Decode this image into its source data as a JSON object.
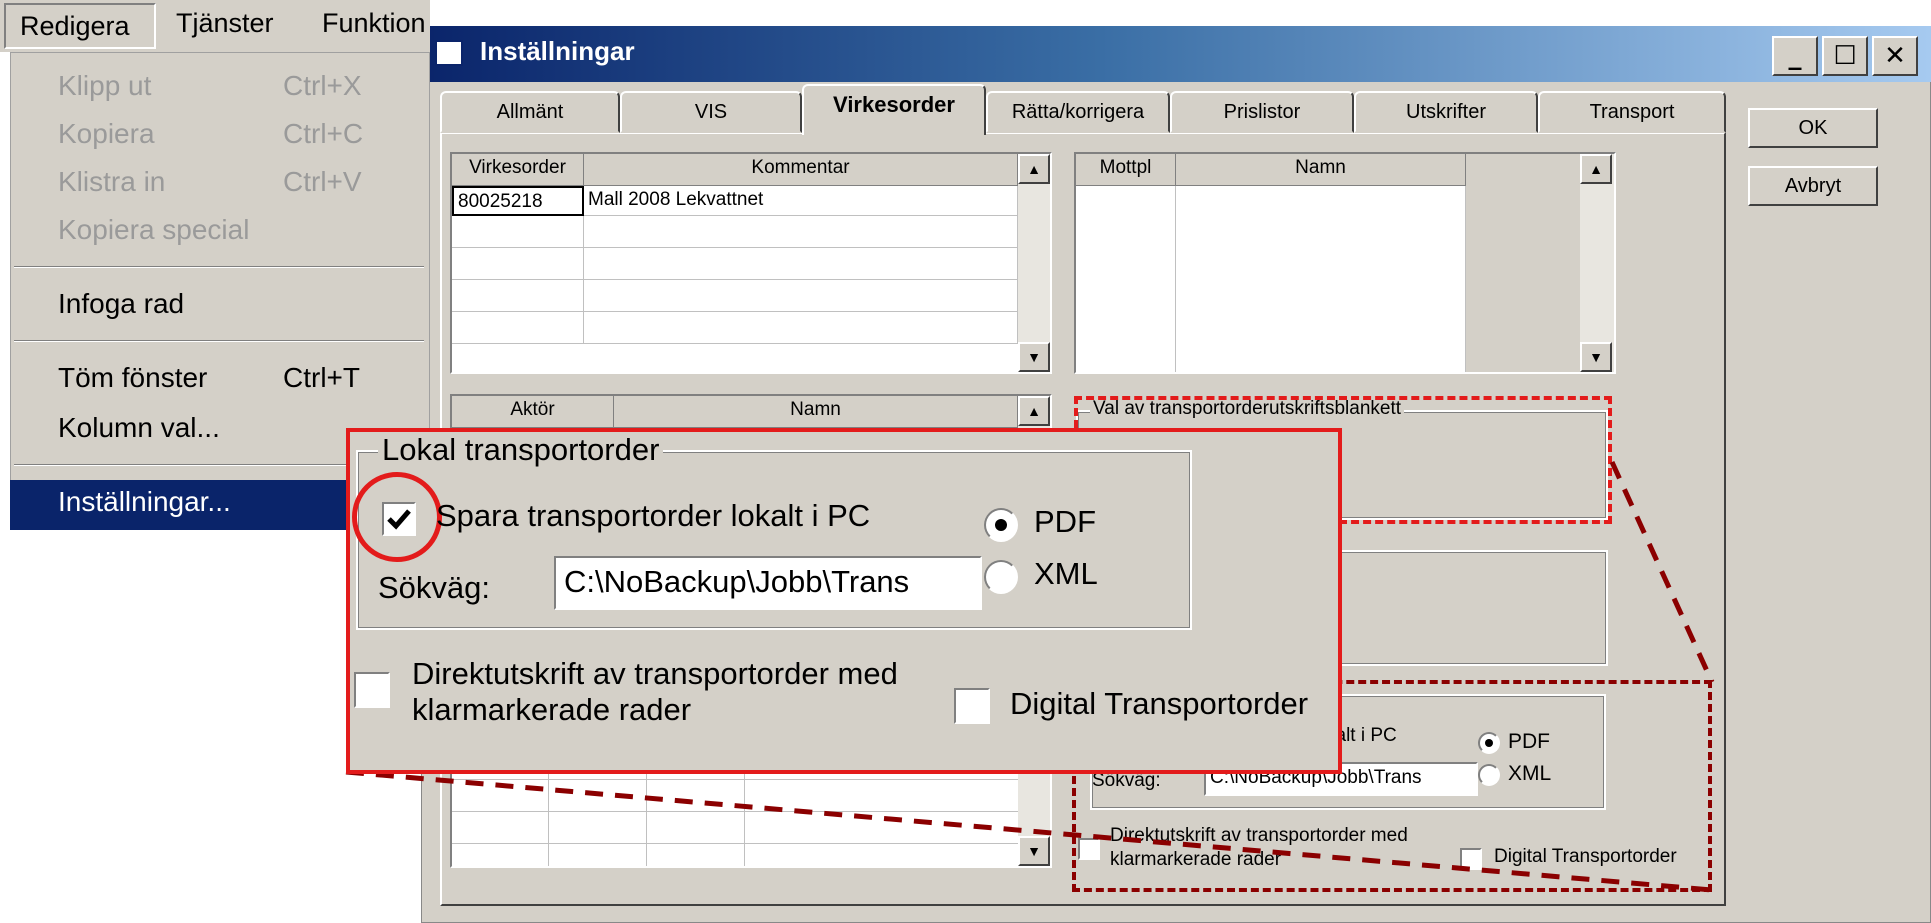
{
  "menu": {
    "top_items": [
      "Redigera",
      "Tjänster",
      "Funktion"
    ],
    "items": [
      {
        "label": "Klipp ut",
        "shortcut": "Ctrl+X"
      },
      {
        "label": "Kopiera",
        "shortcut": "Ctrl+C"
      },
      {
        "label": "Klistra in",
        "shortcut": "Ctrl+V"
      },
      {
        "label": "Kopiera special",
        "shortcut": ""
      },
      {
        "label": "Infoga rad",
        "shortcut": ""
      },
      {
        "label": "Töm fönster",
        "shortcut": "Ctrl+T"
      },
      {
        "label": "Kolumn val...",
        "shortcut": ""
      },
      {
        "label": "Inställningar...",
        "shortcut": ""
      }
    ]
  },
  "window": {
    "title": "Inställningar",
    "controls": [
      "_",
      "☐",
      "✕"
    ],
    "ok_label": "OK",
    "cancel_label": "Avbryt"
  },
  "tabs": [
    "Allmänt",
    "VIS",
    "Virkesorder",
    "Rätta/korrigera",
    "Prislistor",
    "Utskrifter",
    "Transport"
  ],
  "virkesorder_table": {
    "columns": [
      "Virkesorder",
      "Kommentar"
    ],
    "rows": [
      [
        "80025218",
        "Mall 2008 Lekvattnet"
      ]
    ]
  },
  "mottpl_table": {
    "columns": [
      "Mottpl",
      "Namn"
    ]
  },
  "aktor_table": {
    "columns": [
      "Aktör",
      "Namn"
    ]
  },
  "transport_form": {
    "group_title": "Val av transportorderutskriftsblankett",
    "local_group": "Lokal transportorder",
    "save_local_label": "Spara transportorder lokalt i PC",
    "save_local_partial": "kalt i PC",
    "path_label": "Sökväg:",
    "path_value": "C:\\NoBackup\\Jobb\\Trans",
    "format_pdf": "PDF",
    "format_xml": "XML",
    "direct_print_label_1": "Direktutskrift av transportorder med",
    "direct_print_label_2": "klarmarkerade rader",
    "digital_label": "Digital Transportorder",
    "save_local_checked": true,
    "format_selected": "PDF"
  },
  "colors": {
    "highlight_red": "#e31b1b",
    "dashed_dark_red": "#8b0000",
    "menu_selection": "#0a246a"
  }
}
